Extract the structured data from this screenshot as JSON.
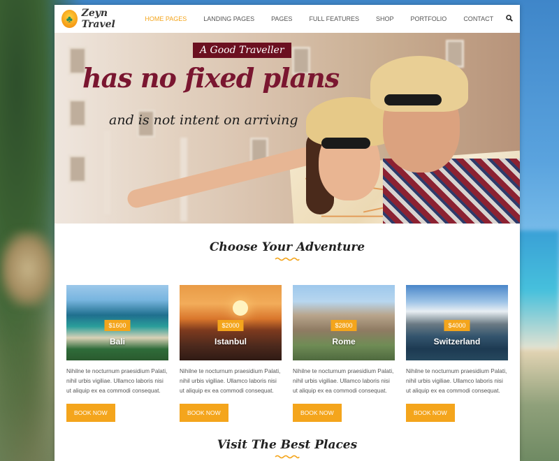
{
  "brand": {
    "name": "Zeyn Travel"
  },
  "nav": {
    "items": [
      {
        "label": "HOME PAGES",
        "active": true
      },
      {
        "label": "LANDING PAGES",
        "active": false
      },
      {
        "label": "PAGES",
        "active": false
      },
      {
        "label": "FULL FEATURES",
        "active": false
      },
      {
        "label": "SHOP",
        "active": false
      },
      {
        "label": "PORTFOLIO",
        "active": false
      },
      {
        "label": "CONTACT",
        "active": false
      }
    ],
    "search_icon": "search-icon"
  },
  "hero": {
    "badge": "A Good Traveller",
    "title": "has no fixed plans",
    "subtitle": "and is not intent on arriving"
  },
  "sections": {
    "adventure_title": "Choose Your Adventure",
    "places_title": "Visit The Best Places"
  },
  "cards": [
    {
      "city": "Bali",
      "price": "$1600",
      "description": "Nihilne te nocturnum praesidium Palati, nihil urbis vigiliae. Ullamco laboris nisi ut aliquip ex ea commodi consequat.",
      "button": "BOOK NOW"
    },
    {
      "city": "Istanbul",
      "price": "$2000",
      "description": "Nihilne te nocturnum praesidium Palati, nihil urbis vigiliae. Ullamco laboris nisi ut aliquip ex ea commodi consequat.",
      "button": "BOOK NOW"
    },
    {
      "city": "Rome",
      "price": "$2800",
      "description": "Nihilne te nocturnum praesidium Palati, nihil urbis vigiliae. Ullamco laboris nisi ut aliquip ex ea commodi consequat.",
      "button": "BOOK NOW"
    },
    {
      "city": "Switzerland",
      "price": "$4000",
      "description": "Nihilne te nocturnum praesidium Palati, nihil urbis vigiliae. Ullamco laboris nisi ut aliquip ex ea commodi consequat.",
      "button": "BOOK NOW"
    }
  ],
  "colors": {
    "accent": "#f4a51c",
    "hero_title": "#7a1630",
    "badge_bg": "#6b1020"
  }
}
